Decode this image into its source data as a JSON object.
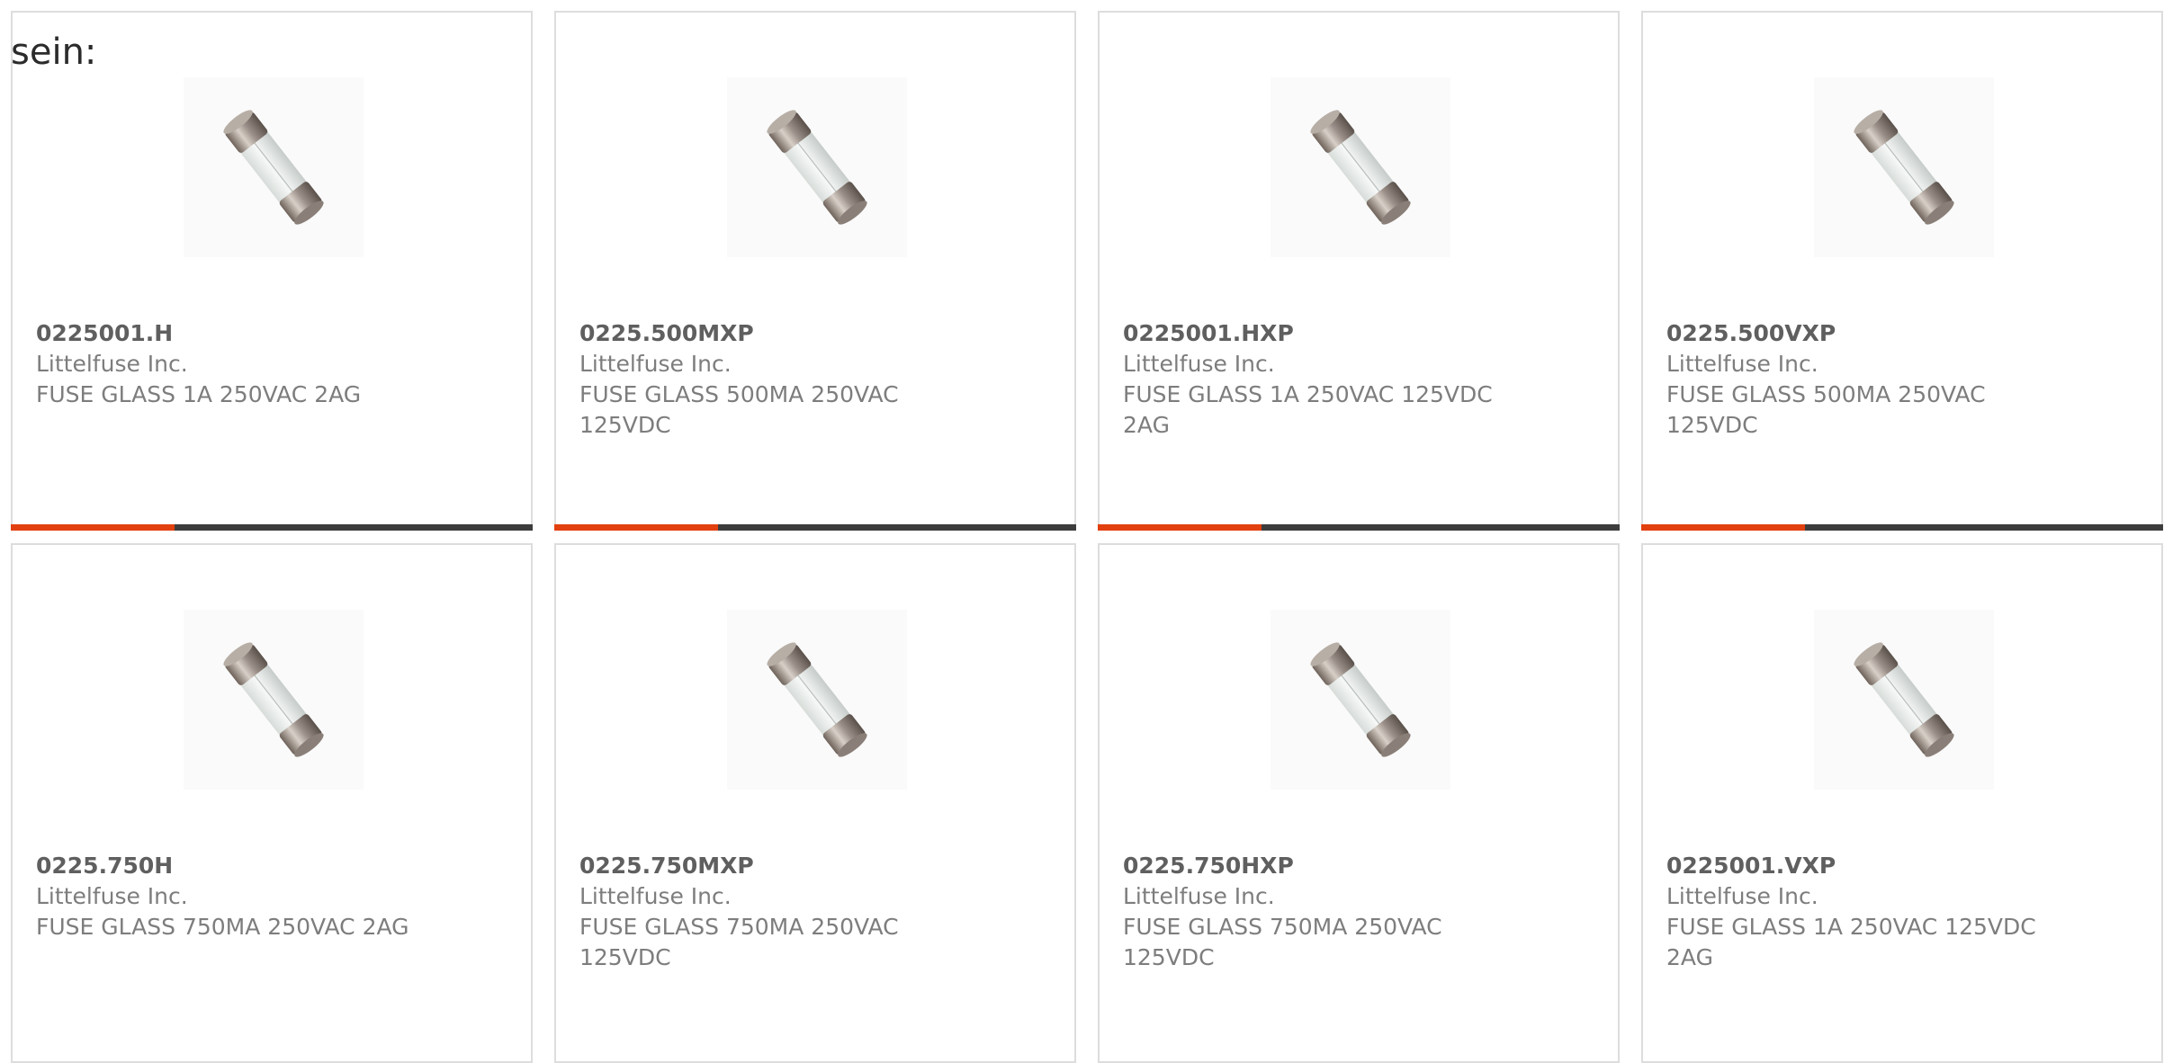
{
  "lead_text": "sein:",
  "accent_color": "#e2400f",
  "bar_color": "#3d3d3d",
  "products": [
    {
      "part_number": "0225001.H",
      "manufacturer": "Littelfuse Inc.",
      "description": "FUSE GLASS 1A 250VAC 2AG",
      "image": "glass-fuse-icon"
    },
    {
      "part_number": "0225.500MXP",
      "manufacturer": "Littelfuse Inc.",
      "description": "FUSE GLASS 500MA 250VAC 125VDC",
      "image": "glass-fuse-icon"
    },
    {
      "part_number": "0225001.HXP",
      "manufacturer": "Littelfuse Inc.",
      "description": "FUSE GLASS 1A 250VAC 125VDC 2AG",
      "image": "glass-fuse-icon"
    },
    {
      "part_number": "0225.500VXP",
      "manufacturer": "Littelfuse Inc.",
      "description": "FUSE GLASS 500MA 250VAC 125VDC",
      "image": "glass-fuse-icon"
    },
    {
      "part_number": "0225.750H",
      "manufacturer": "Littelfuse Inc.",
      "description": "FUSE GLASS 750MA 250VAC 2AG",
      "image": "glass-fuse-icon"
    },
    {
      "part_number": "0225.750MXP",
      "manufacturer": "Littelfuse Inc.",
      "description": "FUSE GLASS 750MA 250VAC 125VDC",
      "image": "glass-fuse-icon"
    },
    {
      "part_number": "0225.750HXP",
      "manufacturer": "Littelfuse Inc.",
      "description": "FUSE GLASS 750MA 250VAC 125VDC",
      "image": "glass-fuse-icon"
    },
    {
      "part_number": "0225001.VXP",
      "manufacturer": "Littelfuse Inc.",
      "description": "FUSE GLASS 1A 250VAC 125VDC 2AG",
      "image": "glass-fuse-icon"
    }
  ]
}
